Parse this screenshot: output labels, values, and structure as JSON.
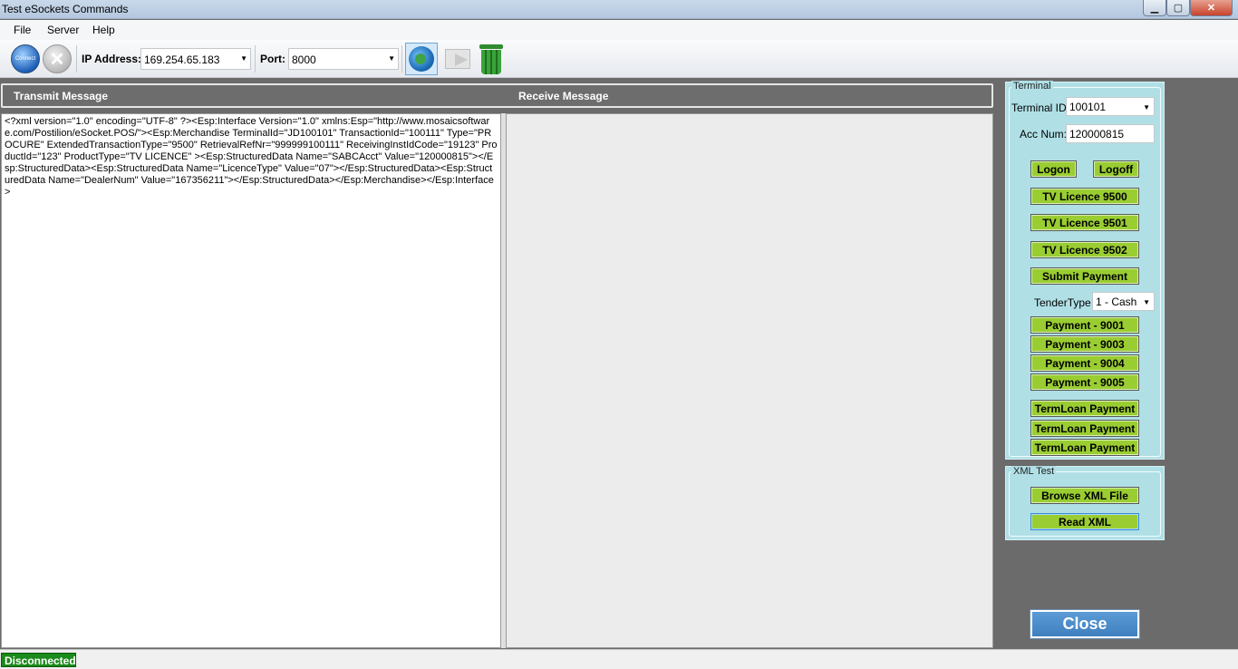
{
  "window": {
    "title": "Test eSockets Commands",
    "min_glyph": "▁",
    "max_glyph": "▢",
    "close_glyph": "✕"
  },
  "menu": {
    "file": "File",
    "server": "Server",
    "help": "Help"
  },
  "toolbar": {
    "connect_icon": "connect-icon",
    "connect_text": "Connect",
    "disconnect_glyph": "✕",
    "ip_label": "IP Address:",
    "ip_value": "169.254.65.183",
    "port_label": "Port:",
    "port_value": "8000",
    "icons": [
      "connect-icon",
      "disconnect-icon",
      "globe-icon",
      "send-mail-icon",
      "trash-icon"
    ]
  },
  "messages": {
    "transmit_label": "Transmit Message",
    "receive_label": "Receive Message",
    "transmit_text": "<?xml version=\"1.0\" encoding=\"UTF-8\" ?><Esp:Interface Version=\"1.0\" xmlns:Esp=\"http://www.mosaicsoftware.com/Postilion/eSocket.POS/\"><Esp:Merchandise TerminalId=\"JD100101\" TransactionId=\"100111\" Type=\"PROCURE\" ExtendedTransactionType=\"9500\" RetrievalRefNr=\"999999100111\" ReceivingInstIdCode=\"19123\" ProductId=\"123\" ProductType=\"TV LICENCE\" ><Esp:StructuredData Name=\"SABCAcct\" Value=\"120000815\"></Esp:StructuredData><Esp:StructuredData Name=\"LicenceType\" Value=\"07\"></Esp:StructuredData><Esp:StructuredData Name=\"DealerNum\" Value=\"167356211\"></Esp:StructuredData></Esp:Merchandise></Esp:Interface>",
    "receive_text": ""
  },
  "terminal": {
    "group_title": "Terminal",
    "terminal_id_label": "Terminal ID:",
    "terminal_id_value": "100101",
    "acc_num_label": "Acc Num:",
    "acc_num_value": "120000815",
    "logon": "Logon",
    "logoff": "Logoff",
    "tv_9500": "TV Licence 9500",
    "tv_9501": "TV Licence 9501",
    "tv_9502": "TV Licence 9502",
    "submit_payment": "Submit Payment",
    "tender_type_label": "TenderType",
    "tender_type_value": "1 - Cash",
    "payment_9001": "Payment - 9001",
    "payment_9003": "Payment - 9003",
    "payment_9004": "Payment - 9004",
    "payment_9005": "Payment - 9005",
    "termloan_1": "TermLoan Payment",
    "termloan_2": "TermLoan Payment",
    "termloan_3": "TermLoan Payment"
  },
  "xml_test": {
    "group_title": "XML Test",
    "browse": "Browse XML File",
    "read": "Read XML"
  },
  "close_button": "Close",
  "status": {
    "connection": "Disconnected"
  },
  "colors": {
    "button_green": "#9acd32",
    "panel_cyan": "#b0e0e6",
    "status_green": "#1a8a1a",
    "close_blue": "#4f8fcb"
  }
}
